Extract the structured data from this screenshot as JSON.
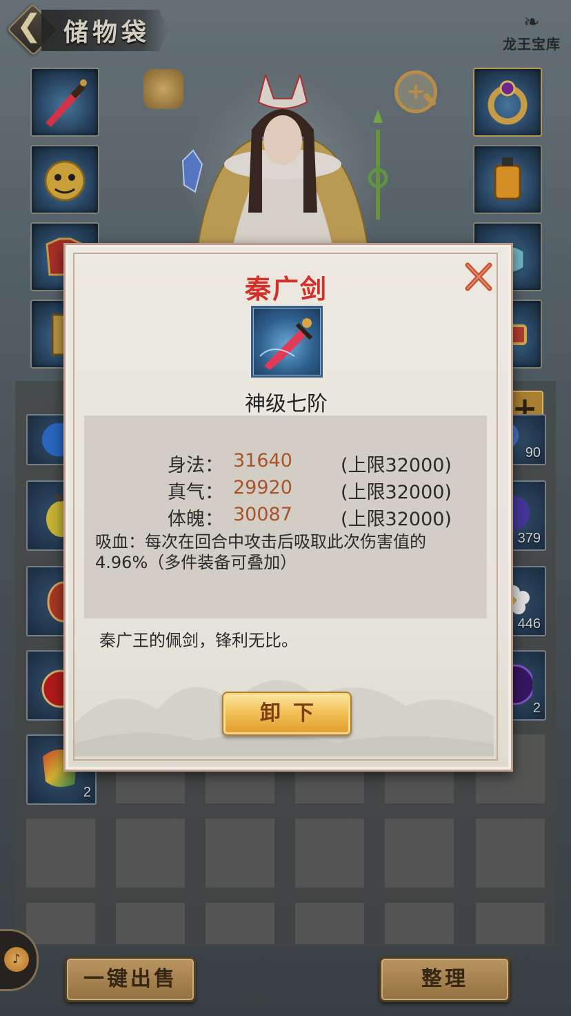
{
  "header": {
    "back_icon": "back-arrow-icon",
    "title": "储物袋",
    "treasure_label": "龙王宝库"
  },
  "equipment": {
    "left_slots": [
      "sword-icon",
      "lion-helmet-icon",
      "armor-icon",
      "boots-icon"
    ],
    "right_slots": [
      "ring-icon",
      "lantern-icon",
      "bracer-icon",
      "belt-icon"
    ]
  },
  "inventory": {
    "items": [
      {
        "icon": "blue-orb-icon",
        "count": ""
      },
      {
        "icon": "yellow-fruit-icon",
        "count": ""
      },
      {
        "icon": "red-gem-icon",
        "count": ""
      },
      {
        "icon": "red-potion-icon",
        "count": ""
      },
      {
        "icon": "rainbow-stone-icon",
        "count": "2"
      },
      {
        "icon": "blue-crystal-icon",
        "count": "90"
      },
      {
        "icon": "purple-gem-icon",
        "count": "379"
      },
      {
        "icon": "white-flower-icon",
        "count": "446"
      },
      {
        "icon": "purple-orb-icon",
        "count": "2"
      }
    ],
    "add_label": "+"
  },
  "dialog": {
    "item_name": "秦广剑",
    "item_icon": "sword-icon",
    "grade": "神级七阶",
    "stats": [
      {
        "label": "身法：",
        "value": "31640",
        "cap": "(上限32000)"
      },
      {
        "label": "真气：",
        "value": "29920",
        "cap": "(上限32000)"
      },
      {
        "label": "体魄：",
        "value": "30087",
        "cap": "(上限32000)"
      }
    ],
    "effect": "吸血：每次在回合中攻击后吸取此次伤害值的4.96%（多件装备可叠加）",
    "description": "秦广王的佩剑，锋利无比。",
    "unequip_label": "卸下",
    "close_icon": "close-icon"
  },
  "footer": {
    "sell_all_label": "一键出售",
    "sort_label": "整理",
    "sound_icon": "speaker-icon"
  },
  "colors": {
    "title_red": "#d3302a",
    "stat_value": "#a9532a",
    "gold_button": "#f2c25a"
  }
}
